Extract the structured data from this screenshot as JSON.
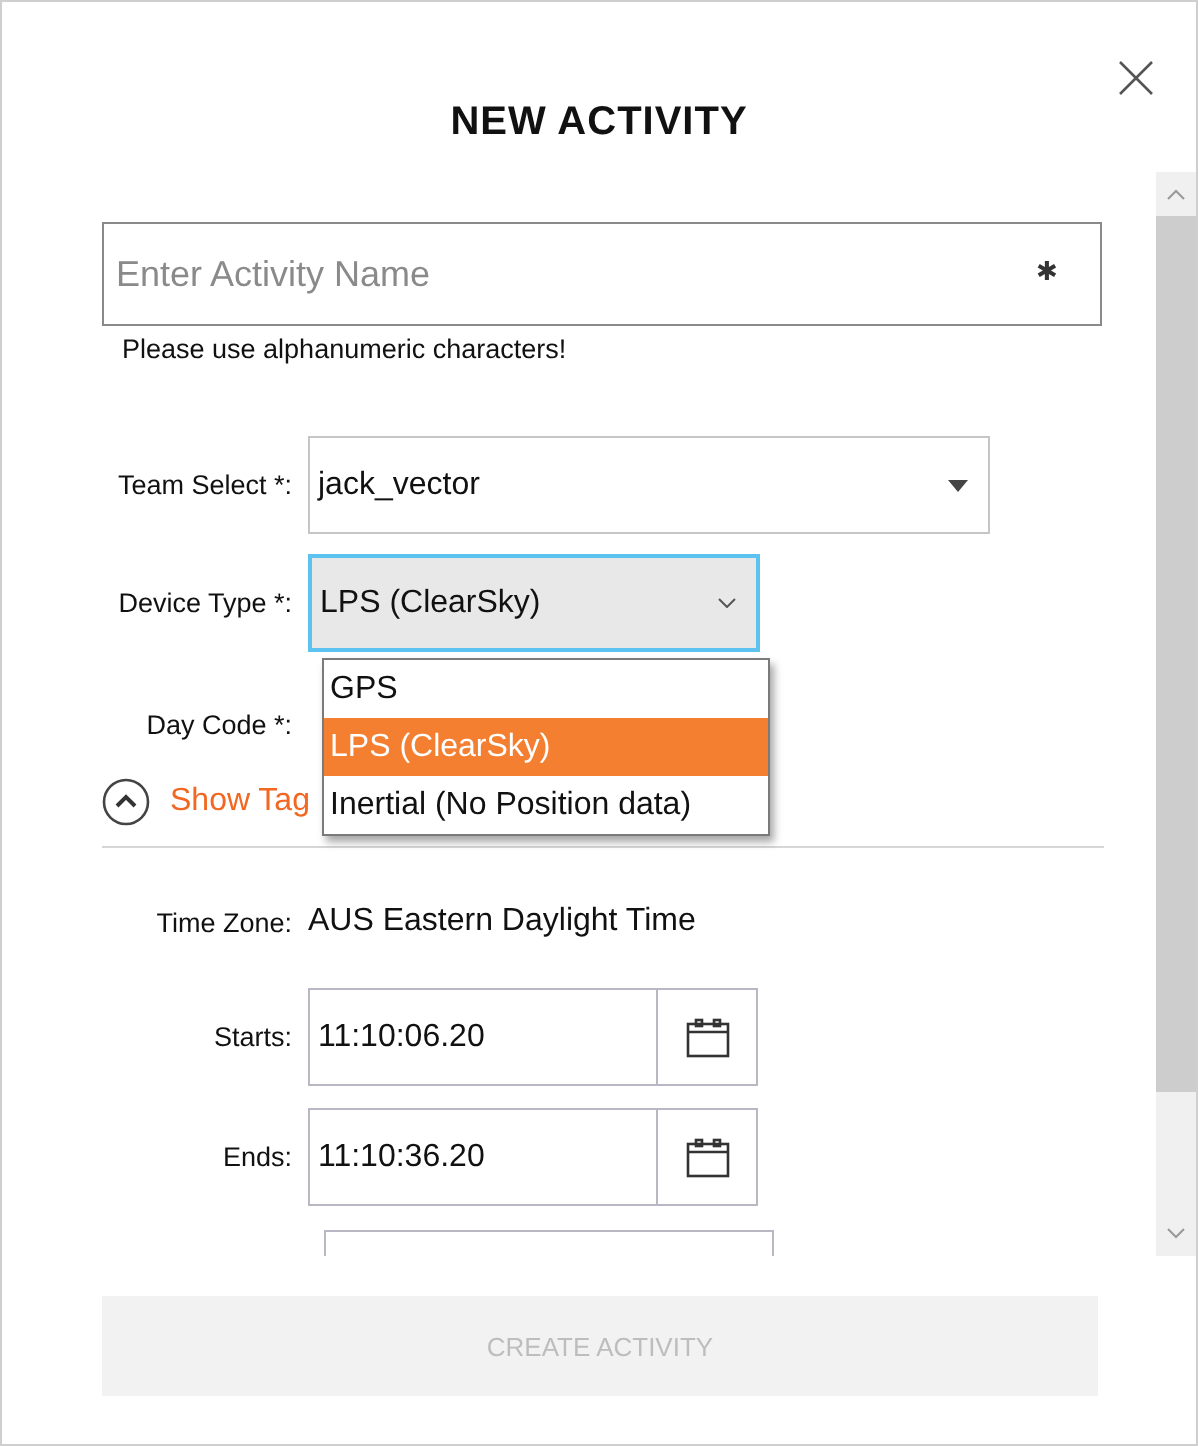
{
  "window": {
    "title": "NEW ACTIVITY"
  },
  "name_field": {
    "placeholder": "Enter Activity Name",
    "required_mark": "✱"
  },
  "hint": "Please use alphanumeric characters!",
  "team_select": {
    "label": "Team Select *:",
    "value": "jack_vector"
  },
  "device_type": {
    "label": "Device Type *:",
    "value": "LPS (ClearSky)",
    "expanded": true,
    "options": [
      {
        "label": "GPS",
        "selected": false
      },
      {
        "label": "LPS (ClearSky)",
        "selected": true
      },
      {
        "label": "Inertial (No Position data)",
        "selected": false
      }
    ]
  },
  "day_code": {
    "label": "Day Code *:"
  },
  "show_tags": {
    "label": "Show Tag"
  },
  "time_zone": {
    "label": "Time Zone:",
    "value": "AUS Eastern Daylight Time"
  },
  "times": [
    {
      "label": "Starts:",
      "value": "11:10:06.20"
    },
    {
      "label": "Ends:",
      "value": "11:10:36.20"
    }
  ],
  "create_button": {
    "label": "CREATE ACTIVITY",
    "disabled": true
  }
}
